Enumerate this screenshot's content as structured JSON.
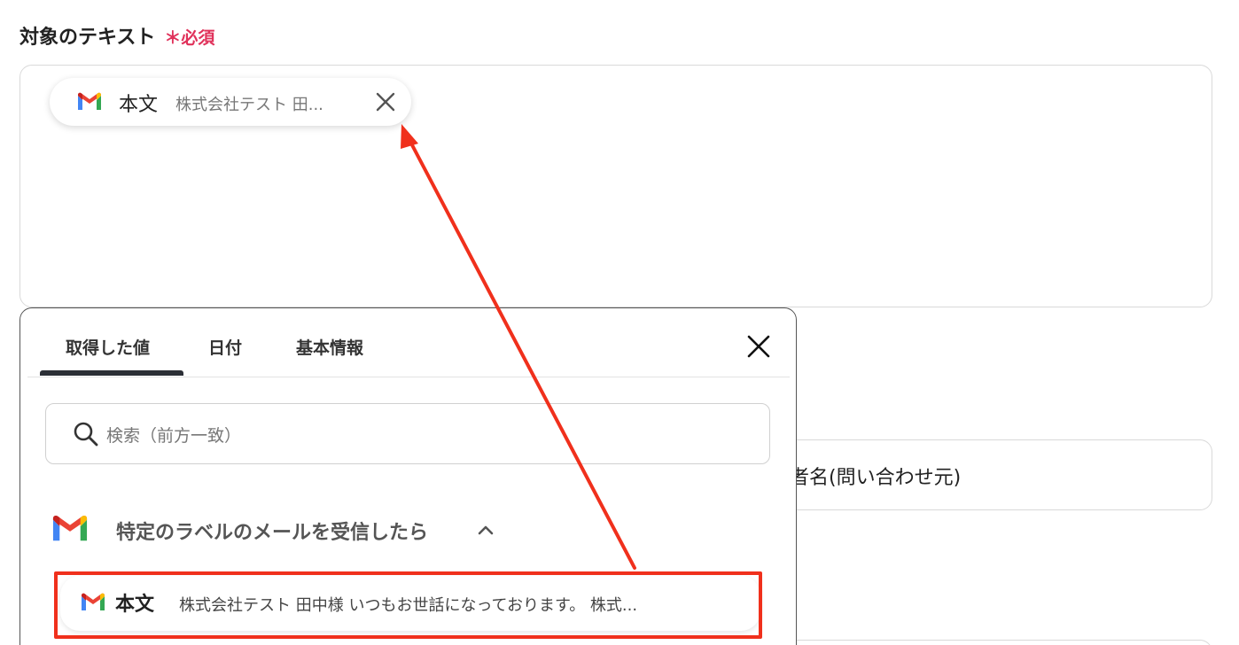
{
  "field": {
    "label": "対象のテキスト",
    "required": "＊必須"
  },
  "chip": {
    "name": "本文",
    "preview": "株式会社テスト 田..."
  },
  "background_fields": {
    "field1_text": "者名(問い合わせ元)"
  },
  "panel": {
    "tabs": [
      {
        "label": "取得した値"
      },
      {
        "label": "日付"
      },
      {
        "label": "基本情報"
      }
    ],
    "search_placeholder": "検索（前方一致）",
    "group_title": "特定のラベルのメールを受信したら",
    "item": {
      "name": "本文",
      "preview": "株式会社テスト 田中様 いつもお世話になっております。 株式..."
    }
  },
  "colors": {
    "required": "#e0315a",
    "highlight": "#f0301c",
    "tab_indicator": "#2b2f36"
  },
  "icons": {
    "source": "gmail-icon",
    "remove": "close-icon",
    "panel_close": "close-icon",
    "search": "search-icon",
    "collapse": "chevron-up-icon"
  }
}
